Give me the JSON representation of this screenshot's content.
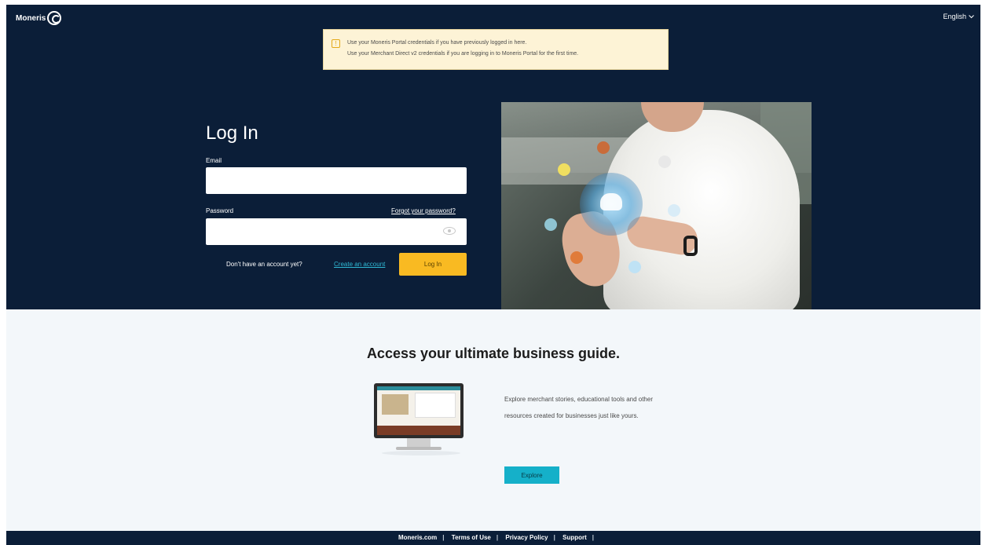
{
  "header": {
    "logo_text": "Moneris",
    "language": "English"
  },
  "notice": {
    "line1": "Use your Moneris Portal credentials if you have previously logged in here.",
    "line2": "Use your Merchant Direct v2 credentials if you are logging in to Moneris Portal for the first time."
  },
  "login": {
    "title": "Log In",
    "email_label": "Email",
    "email_value": "",
    "password_label": "Password",
    "password_value": "",
    "forgot_password": "Forgot your password?",
    "no_account": "Don't have an account yet?",
    "signup_link": "Create an account",
    "login_button": "Log In"
  },
  "promo": {
    "title": "Access your ultimate business guide.",
    "description": "Explore merchant stories, educational tools and other resources created for businesses just like yours.",
    "explore_button": "Explore"
  },
  "footer": {
    "links": [
      "Moneris.com",
      "Terms of Use",
      "Privacy Policy",
      "Support"
    ]
  },
  "colors": {
    "navy": "#0b1e38",
    "accent_yellow": "#f9ba22",
    "teal": "#15b0c9",
    "notice_bg": "#fdf3d6"
  },
  "icons": [
    "moneris-logo-icon",
    "chevron-down-icon",
    "info-icon",
    "eye-icon",
    "monitor-illustration"
  ]
}
